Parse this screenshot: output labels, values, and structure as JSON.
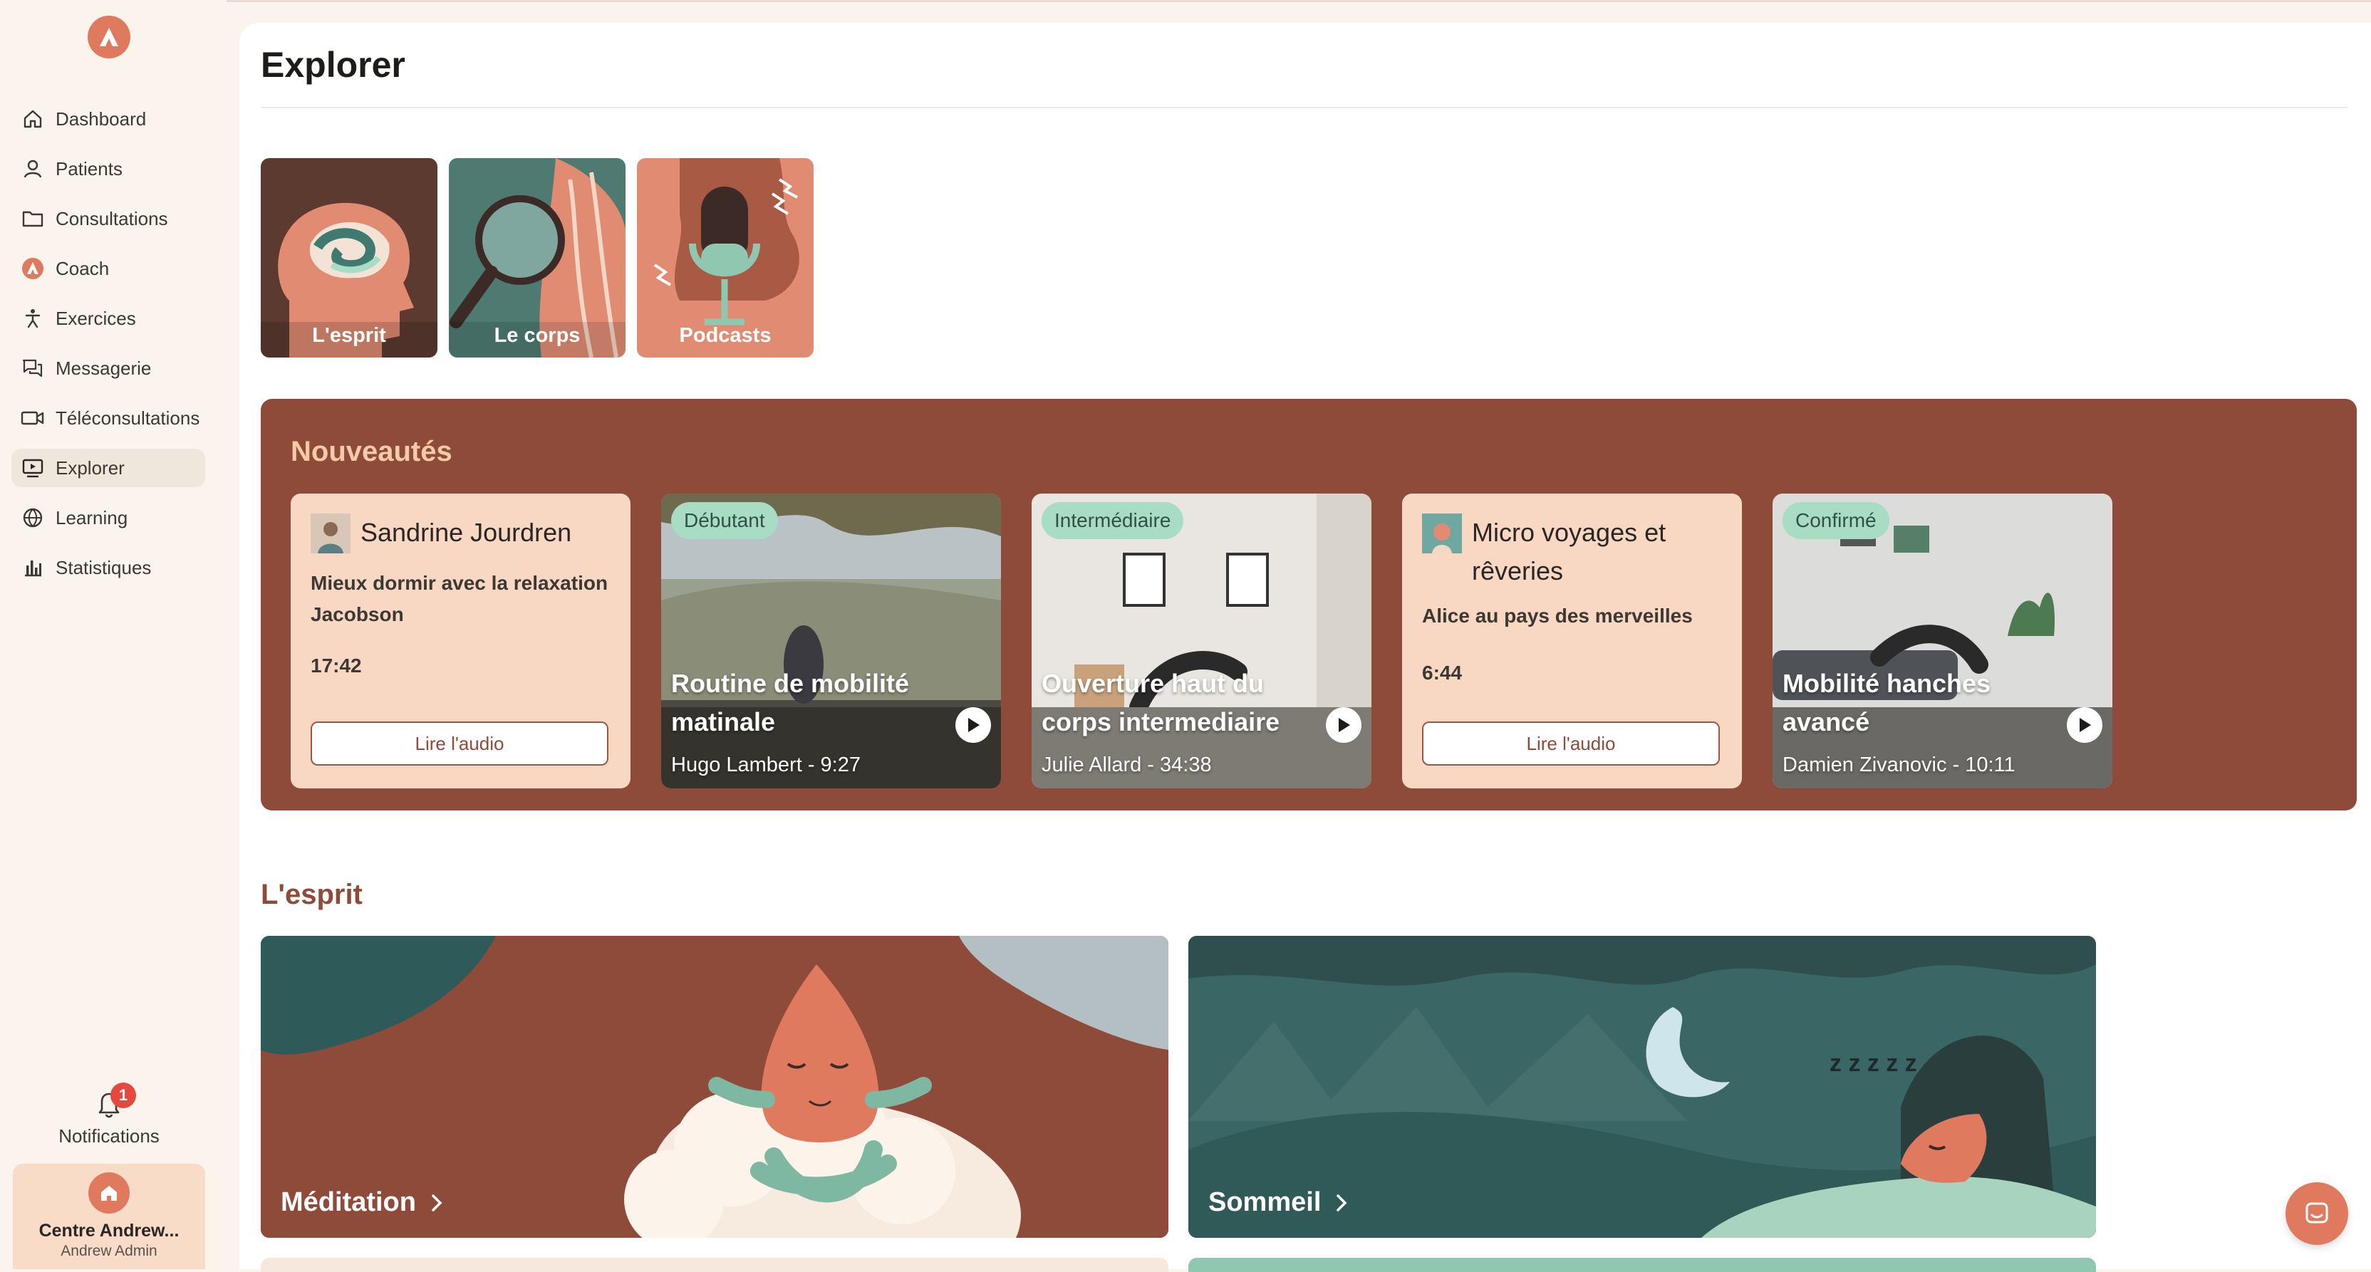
{
  "sidebar": {
    "items": [
      {
        "label": "Dashboard",
        "icon": "home-icon"
      },
      {
        "label": "Patients",
        "icon": "user-icon"
      },
      {
        "label": "Consultations",
        "icon": "folder-icon"
      },
      {
        "label": "Coach",
        "icon": "coach-logo-icon"
      },
      {
        "label": "Exercices",
        "icon": "figure-icon"
      },
      {
        "label": "Messagerie",
        "icon": "chat-icon"
      },
      {
        "label": "Téléconsultations",
        "icon": "video-icon"
      },
      {
        "label": "Explorer",
        "icon": "explore-icon",
        "active": true
      },
      {
        "label": "Learning",
        "icon": "globe-icon"
      },
      {
        "label": "Statistiques",
        "icon": "bar-chart-icon"
      }
    ],
    "notifications": {
      "label": "Notifications",
      "count": "1"
    },
    "center": {
      "name": "Centre Andrew...",
      "user": "Andrew Admin"
    }
  },
  "page": {
    "title": "Explorer"
  },
  "categories": [
    "L'esprit",
    "Le corps",
    "Podcasts"
  ],
  "news": {
    "title": "Nouveautés",
    "audio1": {
      "author": "Sandrine Jourdren",
      "title": "Mieux dormir avec la relaxation Jacobson",
      "duration": "17:42",
      "button": "Lire l'audio"
    },
    "video1": {
      "level": "Débutant",
      "title": "Routine de mobilité matinale",
      "meta": "Hugo Lambert - 9:27"
    },
    "video2": {
      "level": "Intermédiaire",
      "title": "Ouverture haut du corps intermediaire",
      "meta": "Julie Allard - 34:38"
    },
    "audio2": {
      "author": "Micro voyages et rêveries",
      "title": "Alice au pays des merveilles",
      "duration": "6:44",
      "button": "Lire l'audio"
    },
    "video3": {
      "level": "Confirmé",
      "title": "Mobilité hanches avancé",
      "meta": "Damien Zivanovic - 10:11"
    }
  },
  "esprit": {
    "title": "L'esprit",
    "cards": [
      "Méditation",
      "Sommeil"
    ]
  },
  "colors": {
    "accent": "#e07a5f",
    "brown": "#8f4b3a",
    "teal": "#2f5a5a"
  }
}
